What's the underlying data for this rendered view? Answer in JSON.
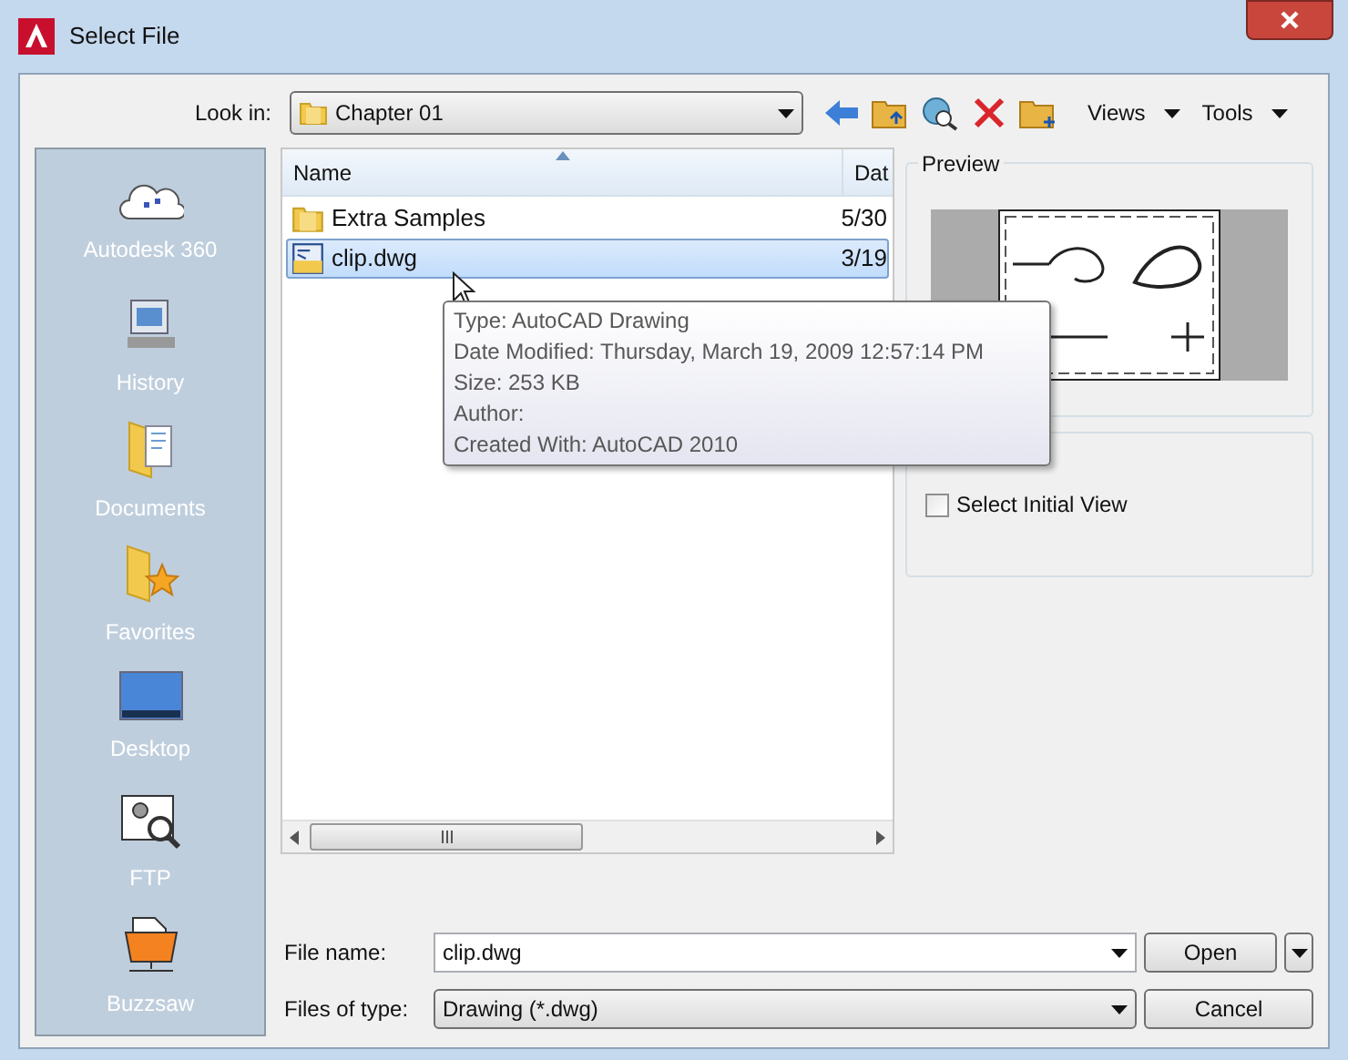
{
  "window": {
    "title": "Select File"
  },
  "look_in": {
    "label": "Look in:",
    "value": "Chapter 01"
  },
  "toolbar": {
    "views": "Views",
    "tools": "Tools"
  },
  "places": [
    {
      "label": "Autodesk 360",
      "kind": "cloud"
    },
    {
      "label": "History",
      "kind": "history"
    },
    {
      "label": "Documents",
      "kind": "documents"
    },
    {
      "label": "Favorites",
      "kind": "favorites"
    },
    {
      "label": "Desktop",
      "kind": "desktop"
    },
    {
      "label": "FTP",
      "kind": "ftp"
    },
    {
      "label": "Buzzsaw",
      "kind": "buzzsaw"
    }
  ],
  "file_list": {
    "columns": [
      "Name",
      "Dat"
    ],
    "rows": [
      {
        "name": "Extra Samples",
        "date": "5/30",
        "kind": "folder",
        "selected": false
      },
      {
        "name": "clip.dwg",
        "date": "3/19",
        "kind": "drawing",
        "selected": true
      }
    ]
  },
  "tooltip": {
    "lines": [
      "Type: AutoCAD Drawing",
      "Date Modified: Thursday, March 19, 2009 12:57:14 PM",
      "Size: 253 KB",
      "Author:",
      "Created With: AutoCAD 2010"
    ]
  },
  "preview": {
    "label": "Preview"
  },
  "select_initial_view": {
    "label": "Select Initial View",
    "checked": false
  },
  "file_name": {
    "label": "File name:",
    "value": "clip.dwg"
  },
  "files_of_type": {
    "label": "Files of type:",
    "value": "Drawing (*.dwg)"
  },
  "buttons": {
    "open": "Open",
    "cancel": "Cancel"
  }
}
